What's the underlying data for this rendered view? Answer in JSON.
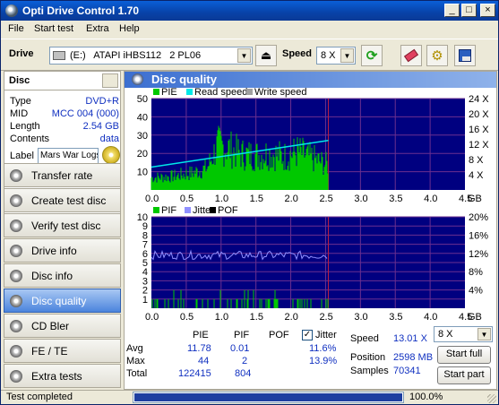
{
  "window": {
    "title": "Opti Drive Control 1.70",
    "buttons": [
      "_",
      "□",
      "×"
    ]
  },
  "menu": [
    "File",
    "Start test",
    "Extra",
    "Help"
  ],
  "toolbar": {
    "drive_label": "Drive",
    "drive_value": "(E:)   ATAPI iHBS112   2 PL06",
    "speed_label": "Speed",
    "speed_value": "8 X"
  },
  "disc": {
    "header": "Disc",
    "rows": [
      {
        "k": "Type",
        "v": "DVD+R"
      },
      {
        "k": "MID",
        "v": "MCC 004 (000)"
      },
      {
        "k": "Length",
        "v": "2.54 GB"
      },
      {
        "k": "Contents",
        "v": "data"
      }
    ],
    "label_key": "Label",
    "label_value": "Mars War Logs"
  },
  "nav": [
    {
      "label": "Transfer rate",
      "active": false
    },
    {
      "label": "Create test disc",
      "active": false
    },
    {
      "label": "Verify test disc",
      "active": false
    },
    {
      "label": "Drive info",
      "active": false
    },
    {
      "label": "Disc info",
      "active": false
    },
    {
      "label": "Disc quality",
      "active": true
    },
    {
      "label": "CD Bler",
      "active": false
    },
    {
      "label": "FE / TE",
      "active": false
    },
    {
      "label": "Extra tests",
      "active": false
    }
  ],
  "panel_title": "Disc quality",
  "colors": {
    "pie": "#00c800",
    "read_speed": "#00e8e8",
    "write_speed": "#a0a0a0",
    "pif": "#00c800",
    "jitter": "#9090ff",
    "pof": "#000000",
    "plot_bg": "#000080",
    "grid": "#6b2f8f",
    "end_marker": "#c02040"
  },
  "chart_data": [
    {
      "type": "bar",
      "legend": [
        "PIE",
        "Read speed",
        "Write speed"
      ],
      "x_ticks": [
        "0.0",
        "0.5",
        "1.0",
        "1.5",
        "2.0",
        "2.5",
        "3.0",
        "3.5",
        "4.0",
        "4.5",
        "GB"
      ],
      "y_left_ticks": [
        "50",
        "40",
        "30",
        "20",
        "10"
      ],
      "y_right_ticks": [
        "24 X",
        "20 X",
        "16 X",
        "12 X",
        "8 X",
        "4 X"
      ],
      "xlim": [
        0,
        4.5
      ],
      "ylim": [
        0,
        50
      ],
      "y2lim": [
        0,
        24
      ],
      "pie_envelope": {
        "x": [
          0.0,
          0.3,
          0.6,
          0.8,
          0.95,
          1.1,
          1.3,
          1.5,
          1.7,
          1.9,
          2.1,
          2.3,
          2.54
        ],
        "y": [
          10,
          11,
          14,
          18,
          36,
          34,
          29,
          28,
          30,
          27,
          31,
          26,
          20
        ]
      },
      "read_speed": {
        "x": [
          0.0,
          2.54
        ],
        "y": [
          6.0,
          13.0
        ]
      },
      "disc_end": 2.54
    },
    {
      "type": "bar",
      "legend": [
        "PIF",
        "Jitter",
        "POF"
      ],
      "x_ticks": [
        "0.0",
        "0.5",
        "1.0",
        "1.5",
        "2.0",
        "2.5",
        "3.0",
        "3.5",
        "4.0",
        "4.5",
        "GB"
      ],
      "y_left_ticks": [
        "10",
        "9",
        "8",
        "7",
        "6",
        "5",
        "4",
        "3",
        "2",
        "1"
      ],
      "y_right_ticks": [
        "20%",
        "16%",
        "12%",
        "8%",
        "4%"
      ],
      "xlim": [
        0,
        4.5
      ],
      "ylim": [
        0,
        10
      ],
      "y2lim": [
        0,
        20
      ],
      "jitter_avg": 11.6,
      "pif_max": 2,
      "disc_end": 2.54
    }
  ],
  "stats": {
    "headers": [
      "PIE",
      "PIF",
      "POF",
      "Jitter"
    ],
    "jitter_checked": true,
    "rows": [
      {
        "label": "Avg",
        "pie": "11.78",
        "pif": "0.01",
        "jitter": "11.6%"
      },
      {
        "label": "Max",
        "pie": "44",
        "pif": "2",
        "jitter": "13.9%"
      },
      {
        "label": "Total",
        "pie": "122415",
        "pif": "804",
        "jitter": ""
      }
    ],
    "speed_label": "Speed",
    "speed_value": "13.01 X",
    "position_label": "Position",
    "position_value": "2598 MB",
    "samples_label": "Samples",
    "samples_value": "70341",
    "speed_select": "8 X",
    "start_full": "Start full",
    "start_part": "Start part"
  },
  "status": {
    "text": "Test completed",
    "progress": 100,
    "percent": "100.0%"
  }
}
